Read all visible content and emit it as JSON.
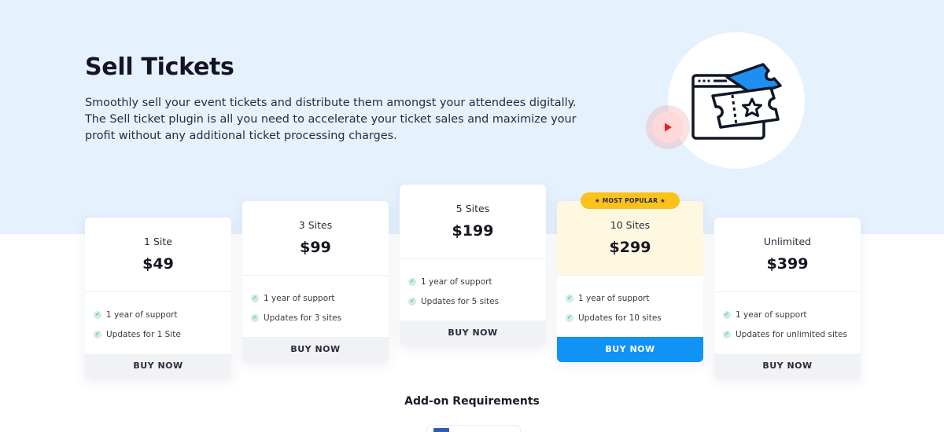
{
  "hero": {
    "title": "Sell Tickets",
    "description": "Smoothly sell your event tickets and distribute them amongst your attendees digitally. The Sell ticket plugin is all you need to accelerate your ticket sales and maximize your profit without any additional ticket processing charges.",
    "background_color": "#e6f1fe",
    "illustration_icon": "ticket-browser-icon",
    "play_icon": "play-icon"
  },
  "colors": {
    "accent_blue": "#1192f5",
    "popular_badge": "#fbc21a",
    "popular_head": "#fff8e1",
    "play_red": "#e02424",
    "check_green": "#2fae6a"
  },
  "plans": [
    {
      "name": "1 Site",
      "price": "$49",
      "features": [
        "1 year of support",
        "Updates for 1 Site"
      ],
      "button": "BUY NOW"
    },
    {
      "name": "3 Sites",
      "price": "$99",
      "features": [
        "1 year of support",
        "Updates for 3 sites"
      ],
      "button": "BUY NOW"
    },
    {
      "name": "5 Sites",
      "price": "$199",
      "features": [
        "1 year of support",
        "Updates for 5 sites"
      ],
      "button": "BUY NOW"
    },
    {
      "name": "10 Sites",
      "price": "$299",
      "features": [
        "1 year of support",
        "Updates for 10 sites"
      ],
      "button": "BUY NOW",
      "badge": "★ MOST POPULAR ★"
    },
    {
      "name": "Unlimited",
      "price": "$399",
      "features": [
        "1 year of support",
        "Updates for unlimited sites"
      ],
      "button": "BUY NOW"
    }
  ],
  "addon": {
    "heading": "Add-on Requirements"
  }
}
